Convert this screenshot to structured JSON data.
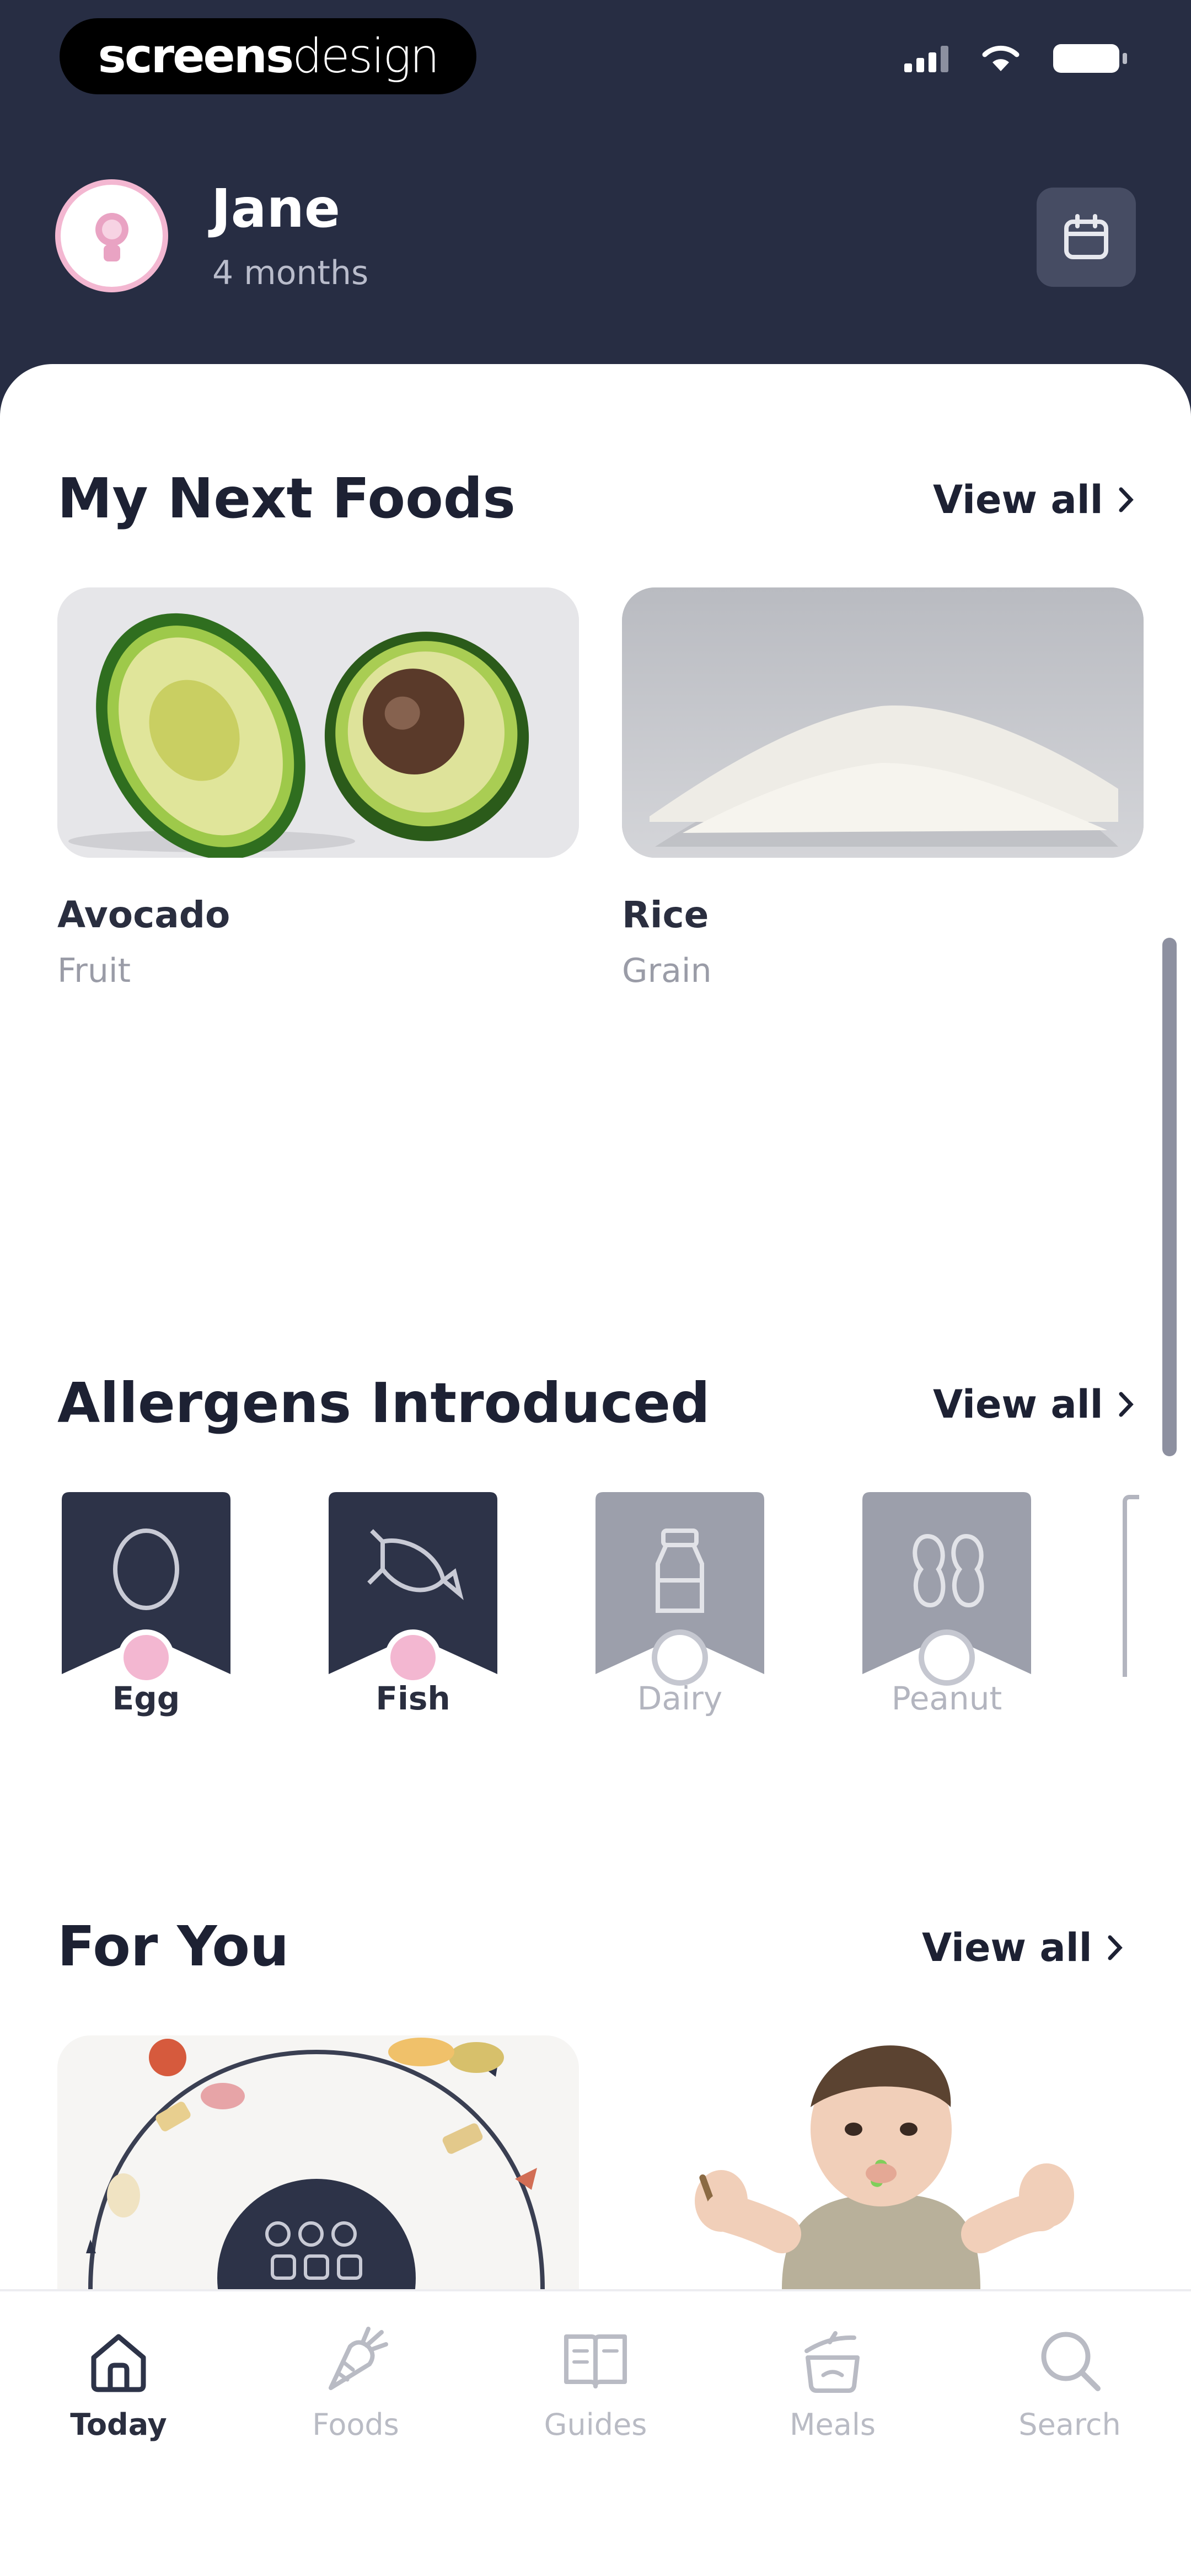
{
  "status_bar": {
    "brand_bold": "screens",
    "brand_light": "design"
  },
  "profile": {
    "name": "Jane",
    "age": "4 months"
  },
  "next_foods": {
    "title": "My Next Foods",
    "view_all": "View all",
    "items": [
      {
        "name": "Avocado",
        "category": "Fruit"
      },
      {
        "name": "Rice",
        "category": "Grain"
      }
    ]
  },
  "allergens": {
    "title": "Allergens Introduced",
    "view_all": "View all",
    "items": [
      {
        "name": "Egg",
        "introduced": true
      },
      {
        "name": "Fish",
        "introduced": true
      },
      {
        "name": "Dairy",
        "introduced": false
      },
      {
        "name": "Peanut",
        "introduced": false
      }
    ]
  },
  "for_you": {
    "title": "For You",
    "view_all": "View all"
  },
  "tabs": [
    {
      "label": "Today",
      "icon": "home-icon",
      "active": true
    },
    {
      "label": "Foods",
      "icon": "carrot-icon",
      "active": false
    },
    {
      "label": "Guides",
      "icon": "book-icon",
      "active": false
    },
    {
      "label": "Meals",
      "icon": "pot-icon",
      "active": false
    },
    {
      "label": "Search",
      "icon": "search-icon",
      "active": false
    }
  ],
  "colors": {
    "header_bg": "#272d43",
    "accent_pink": "#f3b7d1",
    "badge_active": "#2d3348",
    "badge_inactive": "#9c9fab"
  }
}
